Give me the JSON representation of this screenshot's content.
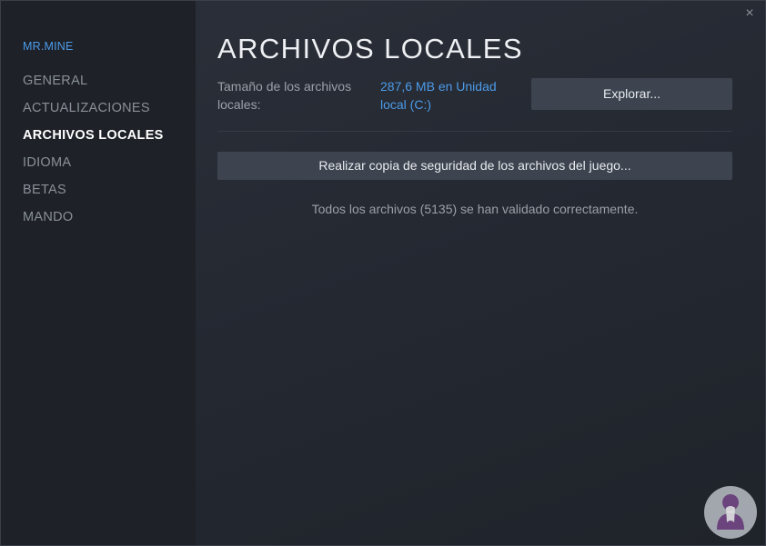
{
  "sidebar": {
    "game_name": "MR.MINE",
    "items": [
      {
        "label": "GENERAL",
        "active": false
      },
      {
        "label": "ACTUALIZACIONES",
        "active": false
      },
      {
        "label": "ARCHIVOS LOCALES",
        "active": true
      },
      {
        "label": "IDIOMA",
        "active": false
      },
      {
        "label": "BETAS",
        "active": false
      },
      {
        "label": "MANDO",
        "active": false
      }
    ]
  },
  "window": {
    "close_icon": "×"
  },
  "main": {
    "title": "ARCHIVOS LOCALES",
    "size_label": "Tamaño de los archivos locales:",
    "size_value": "287,6 MB en Unidad local (C:)",
    "browse_button": "Explorar...",
    "backup_button": "Realizar copia de seguridad de los archivos del juego...",
    "validation_message": "Todos los archivos (5135) se han validado correctamente."
  },
  "colors": {
    "accent_link": "#4c9be8",
    "background": "#252932",
    "sidebar": "#1e2128",
    "button": "#3d4450"
  }
}
